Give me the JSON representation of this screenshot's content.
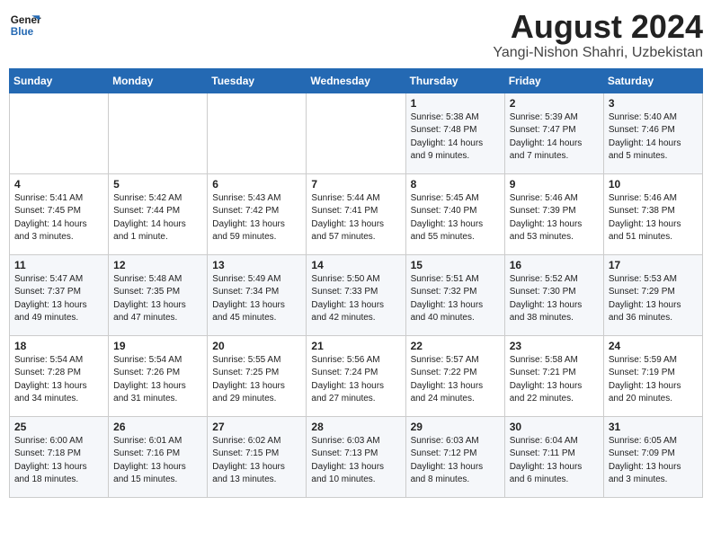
{
  "app": {
    "name": "GeneralBlue",
    "logo_line1": "General",
    "logo_line2": "Blue"
  },
  "calendar": {
    "month": "August 2024",
    "location": "Yangi-Nishon Shahri, Uzbekistan",
    "days_of_week": [
      "Sunday",
      "Monday",
      "Tuesday",
      "Wednesday",
      "Thursday",
      "Friday",
      "Saturday"
    ],
    "weeks": [
      [
        {
          "day": "",
          "info": ""
        },
        {
          "day": "",
          "info": ""
        },
        {
          "day": "",
          "info": ""
        },
        {
          "day": "",
          "info": ""
        },
        {
          "day": "1",
          "info": "Sunrise: 5:38 AM\nSunset: 7:48 PM\nDaylight: 14 hours\nand 9 minutes."
        },
        {
          "day": "2",
          "info": "Sunrise: 5:39 AM\nSunset: 7:47 PM\nDaylight: 14 hours\nand 7 minutes."
        },
        {
          "day": "3",
          "info": "Sunrise: 5:40 AM\nSunset: 7:46 PM\nDaylight: 14 hours\nand 5 minutes."
        }
      ],
      [
        {
          "day": "4",
          "info": "Sunrise: 5:41 AM\nSunset: 7:45 PM\nDaylight: 14 hours\nand 3 minutes."
        },
        {
          "day": "5",
          "info": "Sunrise: 5:42 AM\nSunset: 7:44 PM\nDaylight: 14 hours\nand 1 minute."
        },
        {
          "day": "6",
          "info": "Sunrise: 5:43 AM\nSunset: 7:42 PM\nDaylight: 13 hours\nand 59 minutes."
        },
        {
          "day": "7",
          "info": "Sunrise: 5:44 AM\nSunset: 7:41 PM\nDaylight: 13 hours\nand 57 minutes."
        },
        {
          "day": "8",
          "info": "Sunrise: 5:45 AM\nSunset: 7:40 PM\nDaylight: 13 hours\nand 55 minutes."
        },
        {
          "day": "9",
          "info": "Sunrise: 5:46 AM\nSunset: 7:39 PM\nDaylight: 13 hours\nand 53 minutes."
        },
        {
          "day": "10",
          "info": "Sunrise: 5:46 AM\nSunset: 7:38 PM\nDaylight: 13 hours\nand 51 minutes."
        }
      ],
      [
        {
          "day": "11",
          "info": "Sunrise: 5:47 AM\nSunset: 7:37 PM\nDaylight: 13 hours\nand 49 minutes."
        },
        {
          "day": "12",
          "info": "Sunrise: 5:48 AM\nSunset: 7:35 PM\nDaylight: 13 hours\nand 47 minutes."
        },
        {
          "day": "13",
          "info": "Sunrise: 5:49 AM\nSunset: 7:34 PM\nDaylight: 13 hours\nand 45 minutes."
        },
        {
          "day": "14",
          "info": "Sunrise: 5:50 AM\nSunset: 7:33 PM\nDaylight: 13 hours\nand 42 minutes."
        },
        {
          "day": "15",
          "info": "Sunrise: 5:51 AM\nSunset: 7:32 PM\nDaylight: 13 hours\nand 40 minutes."
        },
        {
          "day": "16",
          "info": "Sunrise: 5:52 AM\nSunset: 7:30 PM\nDaylight: 13 hours\nand 38 minutes."
        },
        {
          "day": "17",
          "info": "Sunrise: 5:53 AM\nSunset: 7:29 PM\nDaylight: 13 hours\nand 36 minutes."
        }
      ],
      [
        {
          "day": "18",
          "info": "Sunrise: 5:54 AM\nSunset: 7:28 PM\nDaylight: 13 hours\nand 34 minutes."
        },
        {
          "day": "19",
          "info": "Sunrise: 5:54 AM\nSunset: 7:26 PM\nDaylight: 13 hours\nand 31 minutes."
        },
        {
          "day": "20",
          "info": "Sunrise: 5:55 AM\nSunset: 7:25 PM\nDaylight: 13 hours\nand 29 minutes."
        },
        {
          "day": "21",
          "info": "Sunrise: 5:56 AM\nSunset: 7:24 PM\nDaylight: 13 hours\nand 27 minutes."
        },
        {
          "day": "22",
          "info": "Sunrise: 5:57 AM\nSunset: 7:22 PM\nDaylight: 13 hours\nand 24 minutes."
        },
        {
          "day": "23",
          "info": "Sunrise: 5:58 AM\nSunset: 7:21 PM\nDaylight: 13 hours\nand 22 minutes."
        },
        {
          "day": "24",
          "info": "Sunrise: 5:59 AM\nSunset: 7:19 PM\nDaylight: 13 hours\nand 20 minutes."
        }
      ],
      [
        {
          "day": "25",
          "info": "Sunrise: 6:00 AM\nSunset: 7:18 PM\nDaylight: 13 hours\nand 18 minutes."
        },
        {
          "day": "26",
          "info": "Sunrise: 6:01 AM\nSunset: 7:16 PM\nDaylight: 13 hours\nand 15 minutes."
        },
        {
          "day": "27",
          "info": "Sunrise: 6:02 AM\nSunset: 7:15 PM\nDaylight: 13 hours\nand 13 minutes."
        },
        {
          "day": "28",
          "info": "Sunrise: 6:03 AM\nSunset: 7:13 PM\nDaylight: 13 hours\nand 10 minutes."
        },
        {
          "day": "29",
          "info": "Sunrise: 6:03 AM\nSunset: 7:12 PM\nDaylight: 13 hours\nand 8 minutes."
        },
        {
          "day": "30",
          "info": "Sunrise: 6:04 AM\nSunset: 7:11 PM\nDaylight: 13 hours\nand 6 minutes."
        },
        {
          "day": "31",
          "info": "Sunrise: 6:05 AM\nSunset: 7:09 PM\nDaylight: 13 hours\nand 3 minutes."
        }
      ]
    ]
  }
}
